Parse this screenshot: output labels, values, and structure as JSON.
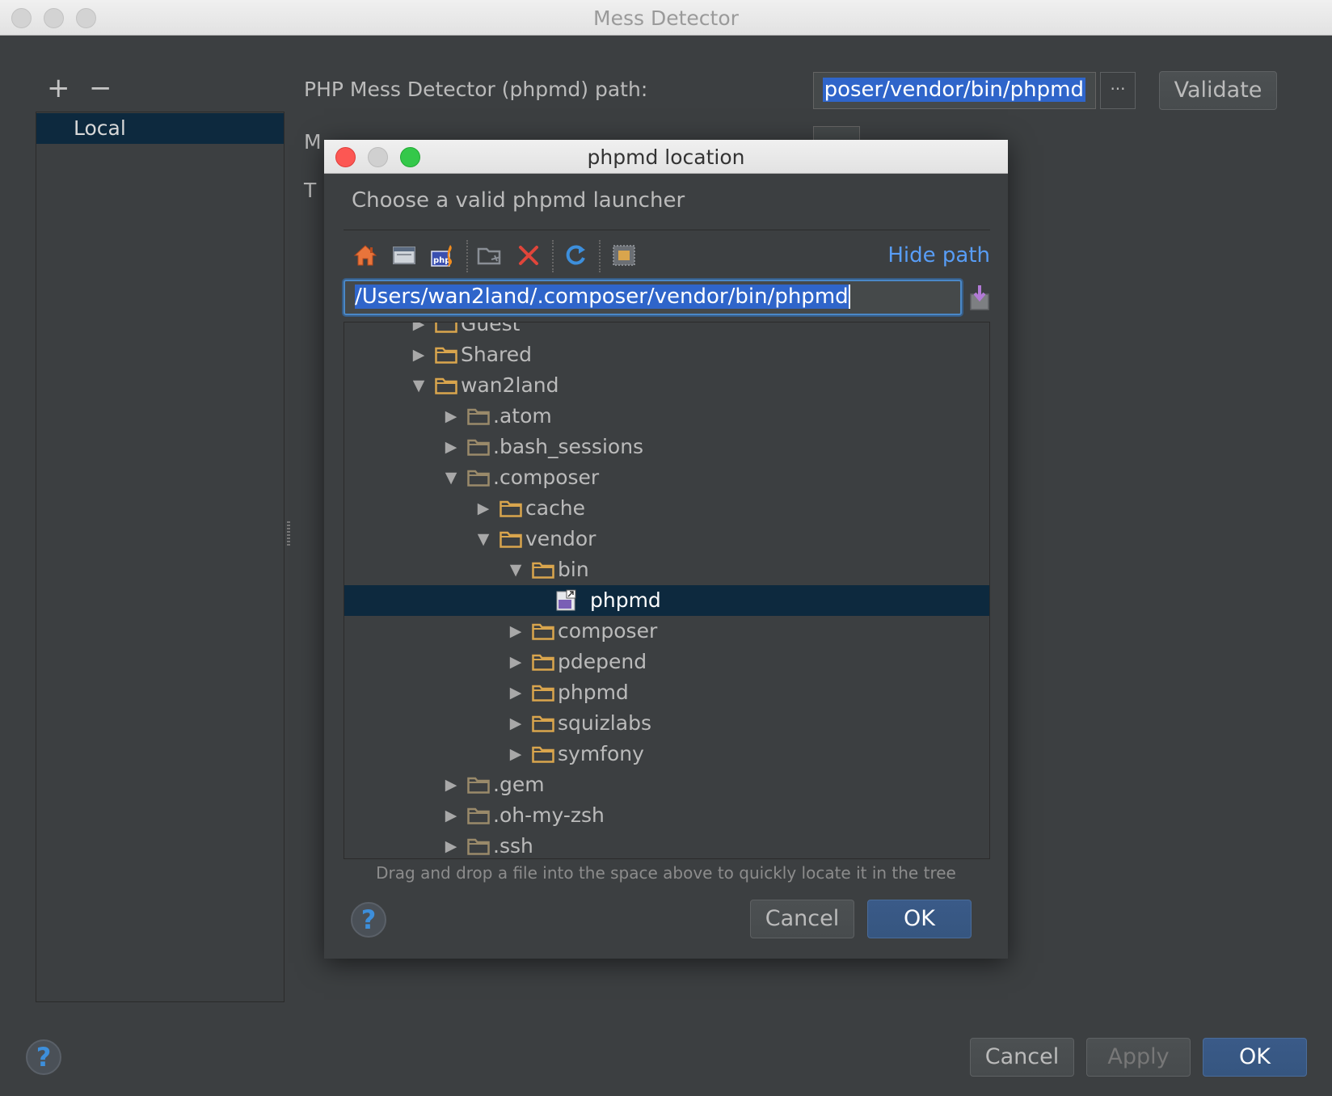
{
  "window": {
    "title": "Mess Detector"
  },
  "sidebar": {
    "add": "+",
    "remove": "−",
    "items": [
      {
        "label": "Local"
      }
    ]
  },
  "settings": {
    "path_label": "PHP Mess Detector (phpmd) path:",
    "path_value": "poser/vendor/bin/phpmd",
    "browse_label": "···",
    "validate_label": "Validate",
    "partial_row2": "M",
    "partial_row3": "T"
  },
  "dialog": {
    "title": "phpmd location",
    "prompt": "Choose a valid phpmd launcher",
    "hide_path": "Hide path",
    "path_input": "/Users/wan2land/.composer/vendor/bin/phpmd",
    "tree": [
      {
        "label": "Guest",
        "depth": 0,
        "state": "collapsed",
        "kind": "folder"
      },
      {
        "label": "Shared",
        "depth": 0,
        "state": "collapsed",
        "kind": "folder"
      },
      {
        "label": "wan2land",
        "depth": 0,
        "state": "expanded",
        "kind": "folder"
      },
      {
        "label": ".atom",
        "depth": 1,
        "state": "collapsed",
        "kind": "hidden-folder"
      },
      {
        "label": ".bash_sessions",
        "depth": 1,
        "state": "collapsed",
        "kind": "hidden-folder"
      },
      {
        "label": ".composer",
        "depth": 1,
        "state": "expanded",
        "kind": "hidden-folder"
      },
      {
        "label": "cache",
        "depth": 2,
        "state": "collapsed",
        "kind": "folder"
      },
      {
        "label": "vendor",
        "depth": 2,
        "state": "expanded",
        "kind": "folder"
      },
      {
        "label": "bin",
        "depth": 3,
        "state": "expanded",
        "kind": "folder"
      },
      {
        "label": "phpmd",
        "depth": 4,
        "state": "leaf",
        "kind": "php-file",
        "selected": true
      },
      {
        "label": "composer",
        "depth": 3,
        "state": "collapsed",
        "kind": "folder"
      },
      {
        "label": "pdepend",
        "depth": 3,
        "state": "collapsed",
        "kind": "folder"
      },
      {
        "label": "phpmd",
        "depth": 3,
        "state": "collapsed",
        "kind": "folder"
      },
      {
        "label": "squizlabs",
        "depth": 3,
        "state": "collapsed",
        "kind": "folder"
      },
      {
        "label": "symfony",
        "depth": 3,
        "state": "collapsed",
        "kind": "folder"
      },
      {
        "label": ".gem",
        "depth": 1,
        "state": "collapsed",
        "kind": "hidden-folder"
      },
      {
        "label": ".oh-my-zsh",
        "depth": 1,
        "state": "collapsed",
        "kind": "hidden-folder"
      },
      {
        "label": ".ssh",
        "depth": 1,
        "state": "collapsed",
        "kind": "hidden-folder"
      }
    ],
    "hint": "Drag and drop a file into the space above to quickly locate it in the tree",
    "help": "?",
    "cancel_label": "Cancel",
    "ok_label": "OK"
  },
  "footer": {
    "help": "?",
    "cancel_label": "Cancel",
    "apply_label": "Apply",
    "ok_label": "OK"
  },
  "icons": {
    "toolbar": [
      "home-icon",
      "desktop-icon",
      "php-project-icon",
      "new-folder-icon",
      "delete-icon",
      "refresh-icon",
      "show-hidden-icon"
    ],
    "path_action": "download-icon"
  },
  "colors": {
    "accent": "#589df6",
    "selection": "#0d293e",
    "highlight": "#2f65ca",
    "folder": "#d9a54d"
  }
}
